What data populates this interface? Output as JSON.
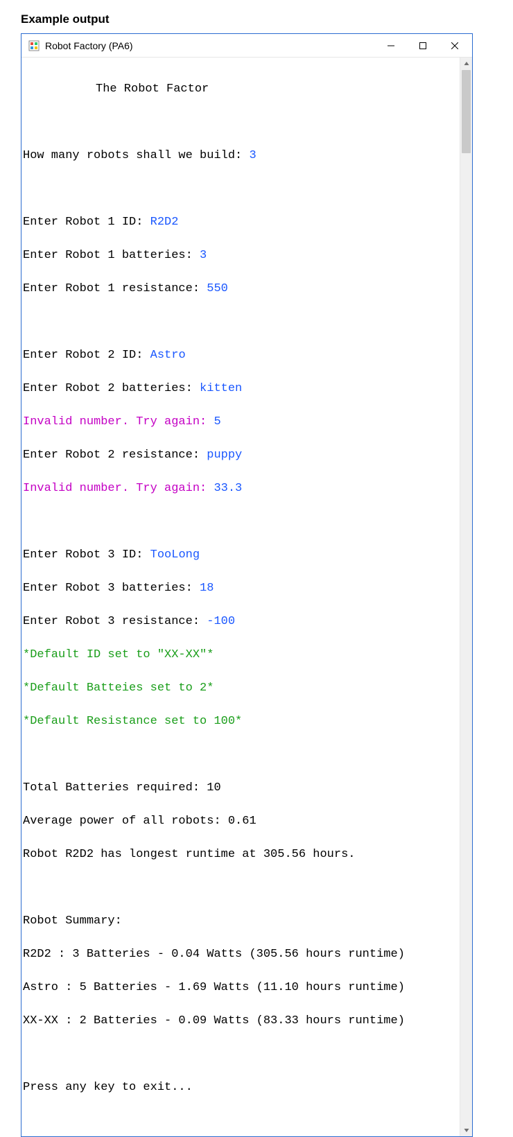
{
  "page_label": "Example output",
  "window": {
    "title": "Robot Factory (PA6)"
  },
  "console": {
    "header": "The Robot Factor",
    "count_prompt": "How many robots shall we build: ",
    "count_value": "3",
    "r1_id_prompt": "Enter Robot 1 ID: ",
    "r1_id_val": "R2D2",
    "r1_bat_prompt": "Enter Robot 1 batteries: ",
    "r1_bat_val": "3",
    "r1_res_prompt": "Enter Robot 1 resistance: ",
    "r1_res_val": "550",
    "r2_id_prompt": "Enter Robot 2 ID: ",
    "r2_id_val": "Astro",
    "r2_bat_prompt": "Enter Robot 2 batteries: ",
    "r2_bat_val": "kitten",
    "err1_prompt": "Invalid number. Try again: ",
    "err1_val": "5",
    "r2_res_prompt": "Enter Robot 2 resistance: ",
    "r2_res_val": "puppy",
    "err2_prompt": "Invalid number. Try again: ",
    "err2_val": "33.3",
    "r3_id_prompt": "Enter Robot 3 ID: ",
    "r3_id_val": "TooLong",
    "r3_bat_prompt": "Enter Robot 3 batteries: ",
    "r3_bat_val": "18",
    "r3_res_prompt": "Enter Robot 3 resistance: ",
    "r3_res_val": "-100",
    "def_id": "*Default ID set to \"XX-XX\"*",
    "def_bat": "*Default Batteies set to 2*",
    "def_res": "*Default Resistance set to 100*",
    "total_bat": "Total Batteries required: 10",
    "avg_power": "Average power of all robots: 0.61",
    "longest": "Robot R2D2 has longest runtime at 305.56 hours.",
    "summary_header": "Robot Summary:",
    "summary1": "R2D2 : 3 Batteries - 0.04 Watts (305.56 hours runtime)",
    "summary2": "Astro : 5 Batteries - 1.69 Watts (11.10 hours runtime)",
    "summary3": "XX-XX : 2 Batteries - 0.09 Watts (83.33 hours runtime)",
    "exit": "Press any key to exit..."
  }
}
